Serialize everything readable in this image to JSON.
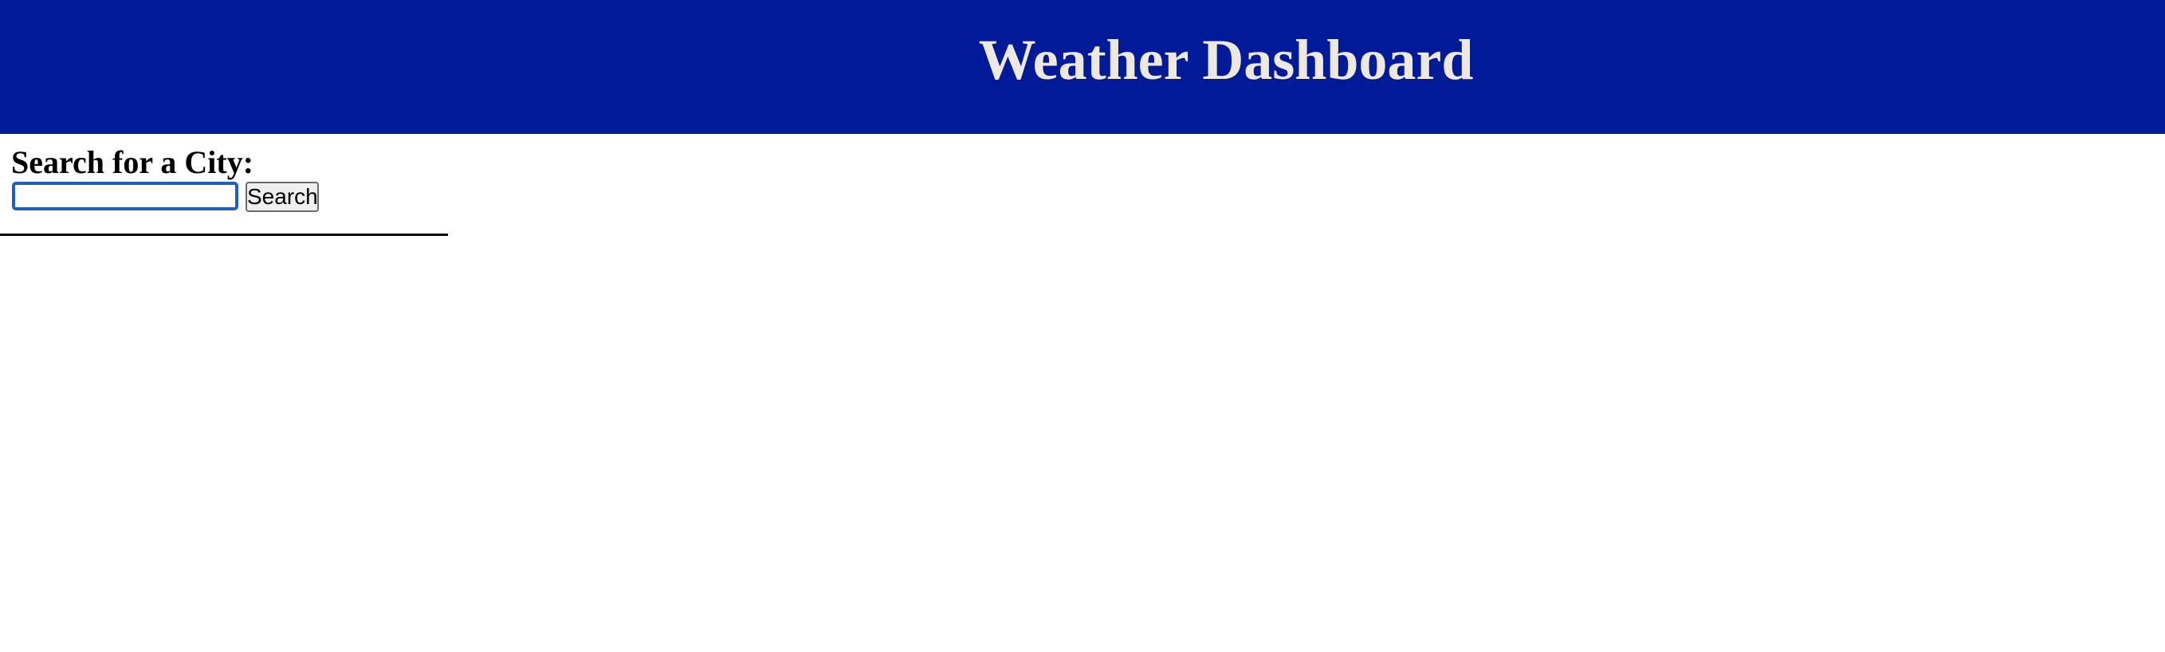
{
  "header": {
    "title": "Weather Dashboard",
    "background_color": "#001a98",
    "title_color": "#eee8e2"
  },
  "search": {
    "heading": "Search for a City:",
    "input_value": "",
    "input_placeholder": "",
    "button_label": "Search",
    "input_focus_color": "#1f5fc4"
  }
}
